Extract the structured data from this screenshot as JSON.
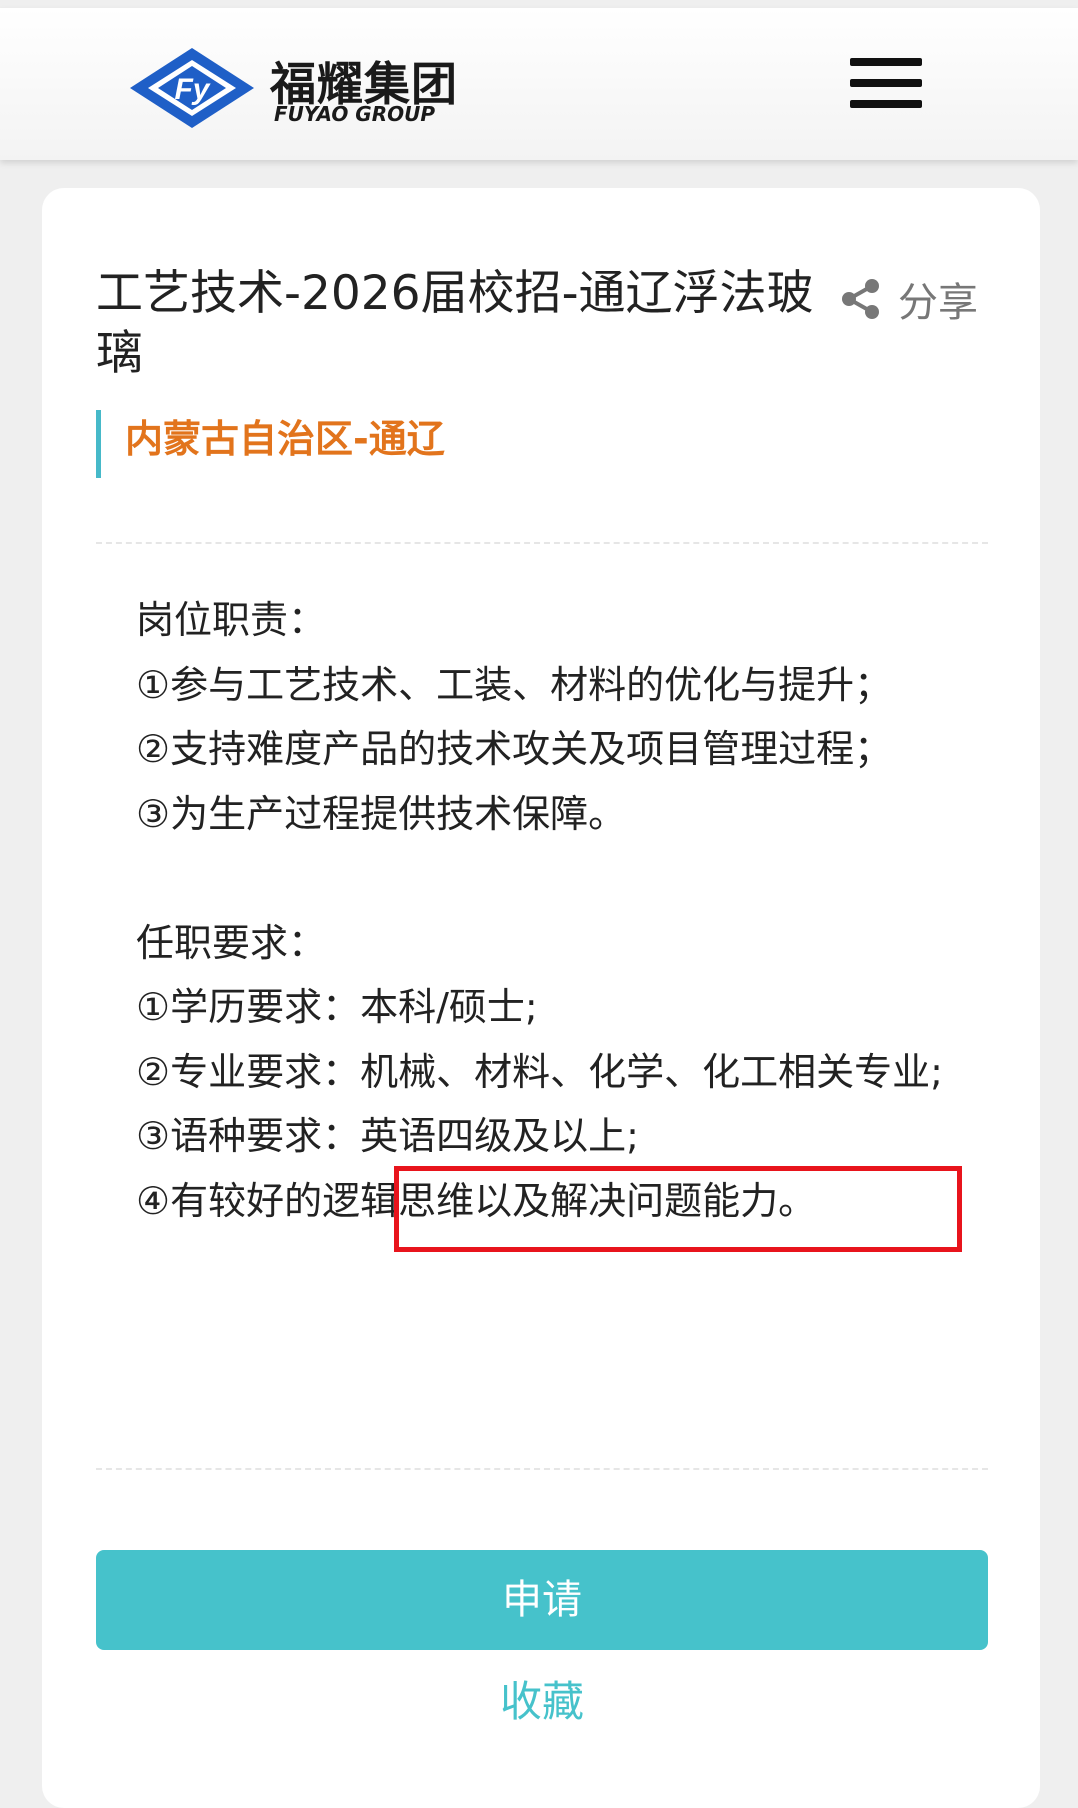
{
  "header": {
    "logo_cn": "福耀集团",
    "logo_en": "FUYAO GROUP",
    "logo_mark_text": "Fy",
    "menu_icon": "hamburger-menu-icon"
  },
  "job": {
    "title": "工艺技术-2026届校招-通辽浮法玻璃",
    "share_label": "分享",
    "share_icon": "share-icon",
    "location": "内蒙古自治区-通辽"
  },
  "description": {
    "lines": [
      "岗位职责：",
      "①参与工艺技术、工装、材料的优化与提升；",
      "②支持难度产品的技术攻关及项目管理过程；",
      "③为生产过程提供技术保障。",
      "",
      "任职要求：",
      "①学历要求：本科/硕士;",
      "②专业要求：机械、材料、化学、化工相关专业;",
      "③语种要求：英语四级及以上;",
      "④有较好的逻辑思维以及解决问题能力。"
    ]
  },
  "actions": {
    "apply_label": "申请",
    "collect_label": "收藏"
  },
  "colors": {
    "accent": "#46c2cb",
    "location_text": "#e2741c",
    "location_bar": "#46b9c9",
    "highlight_border": "#e8141c",
    "logo_blue": "#1f5fc7"
  }
}
